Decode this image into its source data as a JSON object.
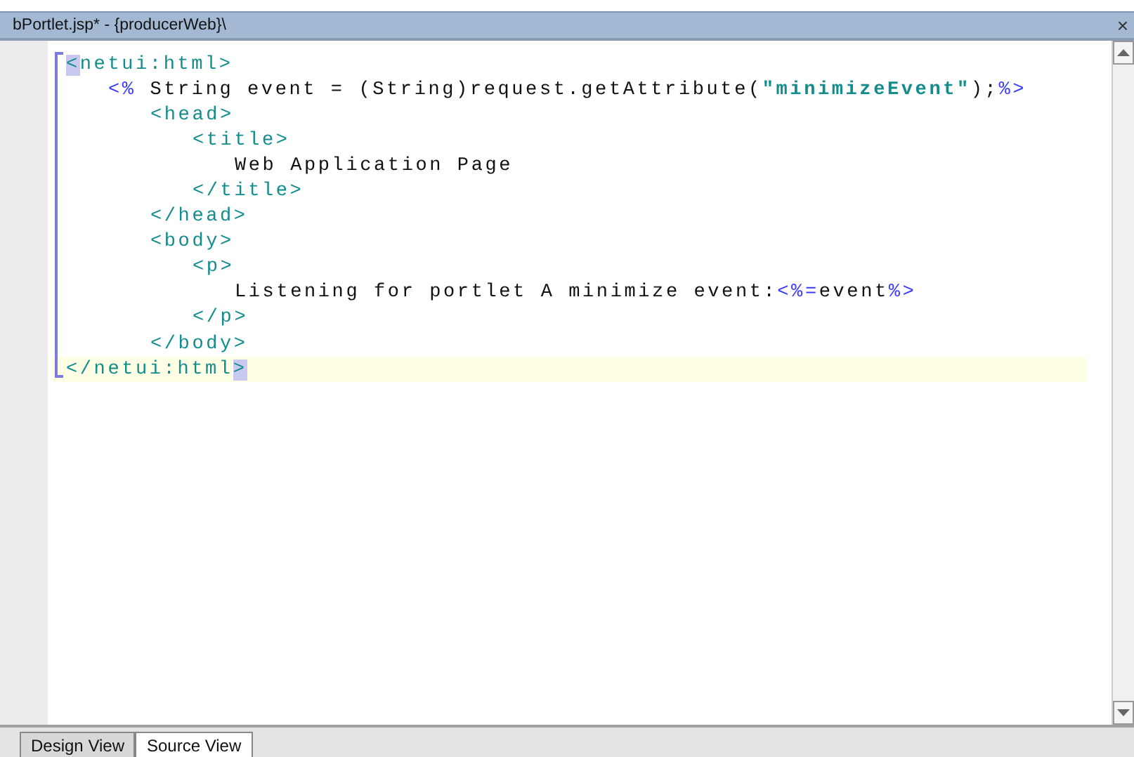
{
  "window": {
    "title": "bPortlet.jsp* - {producerWeb}\\",
    "close": "×"
  },
  "editor": {
    "lines": [
      {
        "current": false,
        "tokens": [
          {
            "kind": "match",
            "text": "<"
          },
          {
            "kind": "tag",
            "text": "netui:html>"
          }
        ],
        "children": [
          {
            "current": false,
            "tokens": [
              {
                "kind": "script",
                "text": "<%"
              },
              {
                "kind": "plain",
                "text": " String event = (String)request.getAttribute("
              },
              {
                "kind": "string",
                "text": "\"minimizeEvent\""
              },
              {
                "kind": "plain",
                "text": ");"
              },
              {
                "kind": "script",
                "text": "%>"
              }
            ],
            "children": [
              {
                "current": false,
                "tokens": [
                  {
                    "kind": "tag",
                    "text": "<head>"
                  }
                ],
                "children": [
                  {
                    "current": false,
                    "tokens": [
                      {
                        "kind": "tag",
                        "text": "<title>"
                      }
                    ],
                    "children": [
                      {
                        "current": false,
                        "tokens": [
                          {
                            "kind": "plain",
                            "text": "Web Application Page"
                          }
                        ]
                      }
                    ]
                  },
                  {
                    "current": false,
                    "tokens": [
                      {
                        "kind": "tag",
                        "text": "</title>"
                      }
                    ]
                  }
                ]
              },
              {
                "current": false,
                "tokens": [
                  {
                    "kind": "tag",
                    "text": "</head>"
                  }
                ]
              },
              {
                "current": false,
                "tokens": [
                  {
                    "kind": "tag",
                    "text": "<body>"
                  }
                ],
                "children": [
                  {
                    "current": false,
                    "tokens": [
                      {
                        "kind": "tag",
                        "text": "<p>"
                      }
                    ],
                    "children": [
                      {
                        "current": false,
                        "tokens": [
                          {
                            "kind": "plain",
                            "text": "Listening for portlet A minimize event:"
                          },
                          {
                            "kind": "script",
                            "text": "<%="
                          },
                          {
                            "kind": "plain",
                            "text": "event"
                          },
                          {
                            "kind": "script",
                            "text": "%>"
                          }
                        ]
                      }
                    ]
                  },
                  {
                    "current": false,
                    "tokens": [
                      {
                        "kind": "tag",
                        "text": "</p>"
                      }
                    ]
                  }
                ]
              },
              {
                "current": false,
                "tokens": [
                  {
                    "kind": "tag",
                    "text": "</body>"
                  }
                ]
              }
            ]
          }
        ]
      },
      {
        "current": true,
        "tokens": [
          {
            "kind": "tag",
            "text": "</netui:html"
          },
          {
            "kind": "match",
            "text": ">"
          }
        ]
      }
    ]
  },
  "tabs": [
    {
      "label": "Design View",
      "selected": false
    },
    {
      "label": "Source View",
      "selected": true
    }
  ]
}
